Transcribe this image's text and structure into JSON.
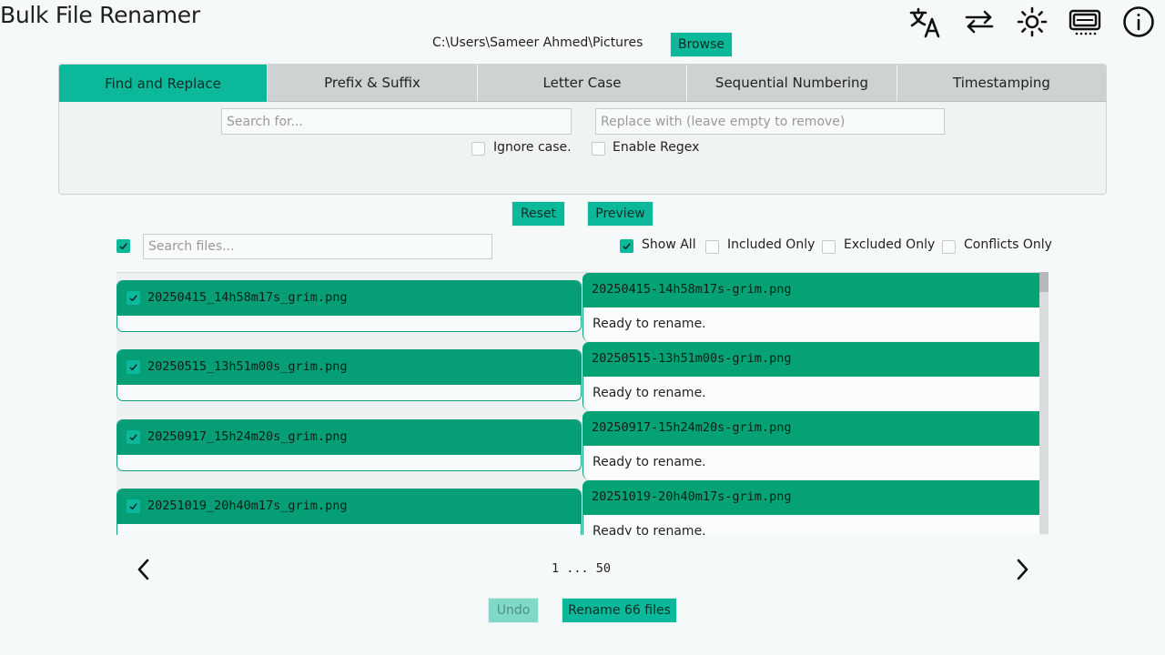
{
  "app": {
    "title": "Bulk File Renamer"
  },
  "path": {
    "current": "C:\\Users\\Sameer Ahmed\\Pictures",
    "browse_label": "Browse"
  },
  "toolbar_icons": [
    "translate-icon",
    "swap-icon",
    "theme-sun-icon",
    "window-mode-icon",
    "info-icon"
  ],
  "tabs": [
    {
      "label": "Find and Replace",
      "active": true
    },
    {
      "label": "Prefix & Suffix",
      "active": false
    },
    {
      "label": "Letter Case",
      "active": false
    },
    {
      "label": "Sequential Numbering",
      "active": false
    },
    {
      "label": "Timestamping",
      "active": false
    }
  ],
  "find_replace": {
    "search_placeholder": "Search for...",
    "replace_placeholder": "Replace with (leave empty to remove)",
    "ignore_case_label": "Ignore case.",
    "ignore_case_checked": false,
    "regex_label": "Enable Regex",
    "regex_checked": false
  },
  "actions": {
    "reset_label": "Reset",
    "preview_label": "Preview"
  },
  "filters": {
    "select_all_checked": true,
    "search_placeholder": "Search files...",
    "show_all_label": "Show All",
    "show_all_checked": true,
    "included_only_label": "Included Only",
    "excluded_only_label": "Excluded Only",
    "conflicts_only_label": "Conflicts Only"
  },
  "files": [
    {
      "original": "20250415_14h58m17s_grim.png",
      "new_name": "20250415-14h58m17s-grim.png",
      "status": "Ready to rename.",
      "checked": true
    },
    {
      "original": "20250515_13h51m00s_grim.png",
      "new_name": "20250515-13h51m00s-grim.png",
      "status": "Ready to rename.",
      "checked": true
    },
    {
      "original": "20250917_15h24m20s_grim.png",
      "new_name": "20250917-15h24m20s-grim.png",
      "status": "Ready to rename.",
      "checked": true
    },
    {
      "original": "20251019_20h40m17s_grim.png",
      "new_name": "20251019-20h40m17s-grim.png",
      "status": "Ready to rename.",
      "checked": true
    }
  ],
  "pagination": {
    "text": "1 ... 50"
  },
  "footer": {
    "undo_label": "Undo",
    "rename_label": "Rename 66 files"
  },
  "colors": {
    "accent": "#0cb89a",
    "card_header": "#069e76",
    "tab_inactive": "#cdd2d2"
  }
}
